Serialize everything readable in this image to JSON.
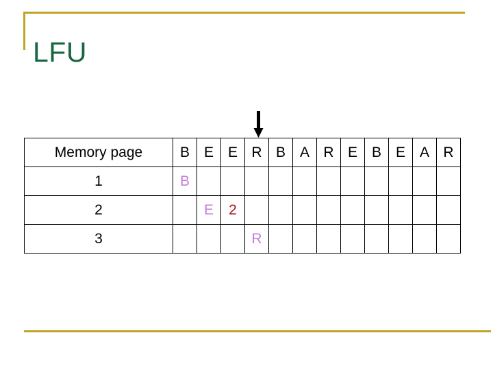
{
  "slide": {
    "title": "LFU",
    "title_color": "#1A6640",
    "frame_color": "#BFA429",
    "background_color": "#FFFFFF"
  },
  "pointer": {
    "icon": "arrow-down-icon",
    "color": "#000000",
    "points_to_column_index": 3,
    "points_to_reference": "R"
  },
  "table": {
    "row_header_label": "Memory page",
    "reference_string": [
      "B",
      "E",
      "E",
      "R",
      "B",
      "A",
      "R",
      "E",
      "B",
      "E",
      "A",
      "R"
    ],
    "frame_rows": [
      {
        "label": "1",
        "cells": [
          "B",
          "",
          "",
          "",
          "",
          "",
          "",
          "",
          "",
          "",
          "",
          ""
        ],
        "colors": [
          "#C57FDB",
          "",
          "",
          "",
          "",
          "",
          "",
          "",
          "",
          "",
          "",
          ""
        ]
      },
      {
        "label": "2",
        "cells": [
          "",
          "E",
          "2",
          "",
          "",
          "",
          "",
          "",
          "",
          "",
          "",
          ""
        ],
        "colors": [
          "",
          "#C57FDB",
          "#A3151E",
          "",
          "",
          "",
          "",
          "",
          "",
          "",
          "",
          ""
        ]
      },
      {
        "label": "3",
        "cells": [
          "",
          "",
          "",
          "R",
          "",
          "",
          "",
          "",
          "",
          "",
          "",
          ""
        ],
        "colors": [
          "",
          "",
          "",
          "#C57FDB",
          "",
          "",
          "",
          "",
          "",
          "",
          "",
          ""
        ]
      }
    ]
  }
}
